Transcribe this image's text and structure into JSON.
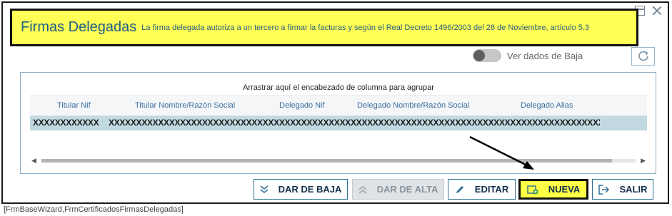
{
  "title": {
    "main": "Firmas Delegadas",
    "subtitle": "La firma delegada autoriza a un tercero a firmar la facturas y según el Real Decreto 1496/2003 del 28 de Noviembre, artículo 5.3",
    "highlight_color": "#ffff55"
  },
  "toggle": {
    "label": "Ver dados de Baja",
    "checked": false
  },
  "grid": {
    "group_hint": "Arrastrar aquí el encabezado de columna para agrupar",
    "columns": [
      "Titular Nif",
      "Titular Nombre/Razón Social",
      "Delegado Nif",
      "Delegado Nombre/Razón Social",
      "Delegado Alias"
    ],
    "rows": [
      [
        "XXXXXXXXXXXX",
        "XXXXXXXXXXXXXXXXXXXXXXXXXXXXXXXXXXXXXXXXXXXXXXXXXXXXXXXXXXXXXXXXXXXXXXXXXXXXXXXXXXXXXXXXXX"
      ]
    ],
    "selected_row_color": "#c2d9e1"
  },
  "buttons": {
    "dar_de_baja": "DAR DE BAJA",
    "dar_de_alta": "DAR DE ALTA",
    "editar": "EDITAR",
    "nueva": "NUEVA",
    "salir": "SALIR"
  },
  "icons": {
    "refresh": "refresh-icon",
    "dar_de_baja": "double-chevron-down-icon",
    "dar_de_alta": "double-chevron-up-icon",
    "editar": "pencil-icon",
    "nueva": "new-document-icon",
    "salir": "exit-icon"
  },
  "status_bar": "[FrmBaseWizard,FrmCertificadosFirmasDelegadas]"
}
